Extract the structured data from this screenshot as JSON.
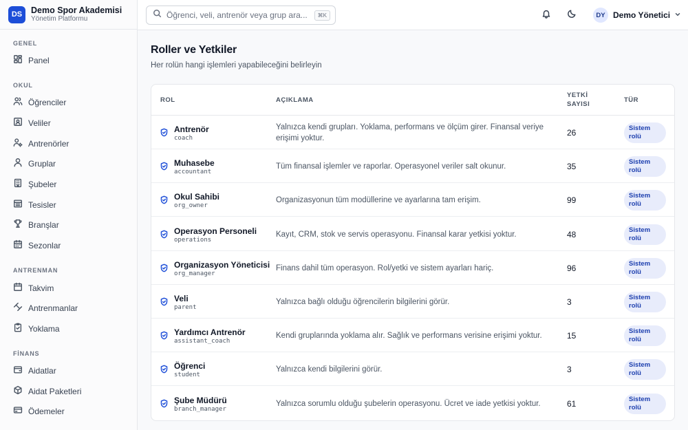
{
  "brand": {
    "logo": "DS",
    "name": "Demo Spor Akademisi",
    "subtitle": "Yönetim Platformu"
  },
  "search": {
    "placeholder": "Öğrenci, veli, antrenör veya grup ara...",
    "shortcut": "⌘K"
  },
  "header_icons": [
    "bell-icon",
    "moon-icon"
  ],
  "user": {
    "initials": "DY",
    "name": "Demo Yönetici"
  },
  "sidebar": {
    "sections": [
      {
        "title": "GENEL",
        "items": [
          {
            "label": "Panel",
            "icon": "dashboard-icon"
          }
        ]
      },
      {
        "title": "OKUL",
        "items": [
          {
            "label": "Öğrenciler",
            "icon": "users-icon"
          },
          {
            "label": "Veliler",
            "icon": "contact-card-icon"
          },
          {
            "label": "Antrenörler",
            "icon": "user-cog-icon"
          },
          {
            "label": "Gruplar",
            "icon": "user-icon"
          },
          {
            "label": "Şubeler",
            "icon": "building-icon"
          },
          {
            "label": "Tesisler",
            "icon": "facility-icon"
          },
          {
            "label": "Branşlar",
            "icon": "trophy-icon"
          },
          {
            "label": "Sezonlar",
            "icon": "calendar-days-icon"
          }
        ]
      },
      {
        "title": "ANTRENMAN",
        "items": [
          {
            "label": "Takvim",
            "icon": "calendar-icon"
          },
          {
            "label": "Antrenmanlar",
            "icon": "dumbbell-icon"
          },
          {
            "label": "Yoklama",
            "icon": "clipboard-check-icon"
          }
        ]
      },
      {
        "title": "FİNANS",
        "items": [
          {
            "label": "Aidatlar",
            "icon": "wallet-icon"
          },
          {
            "label": "Aidat Paketleri",
            "icon": "package-icon"
          },
          {
            "label": "Ödemeler",
            "icon": "credit-card-icon"
          }
        ]
      }
    ]
  },
  "page": {
    "title": "Roller ve Yetkiler",
    "subtitle": "Her rolün hangi işlemleri yapabileceğini belirleyin"
  },
  "table": {
    "headers": {
      "role": "ROL",
      "description": "AÇIKLAMA",
      "count_line1": "YETKİ",
      "count_line2": "SAYISI",
      "type": "TÜR"
    },
    "rows": [
      {
        "name": "Antrenör",
        "code": "coach",
        "description": "Yalnızca kendi grupları. Yoklama, performans ve ölçüm girer. Finansal veriye erişimi yoktur.",
        "count": "26",
        "type_line1": "Sistem",
        "type_line2": "rolü"
      },
      {
        "name": "Muhasebe",
        "code": "accountant",
        "description": "Tüm finansal işlemler ve raporlar. Operasyonel veriler salt okunur.",
        "count": "35",
        "type_line1": "Sistem",
        "type_line2": "rolü"
      },
      {
        "name": "Okul Sahibi",
        "code": "org_owner",
        "description": "Organizasyonun tüm modüllerine ve ayarlarına tam erişim.",
        "count": "99",
        "type_line1": "Sistem",
        "type_line2": "rolü"
      },
      {
        "name": "Operasyon Personeli",
        "code": "operations",
        "description": "Kayıt, CRM, stok ve servis operasyonu. Finansal karar yetkisi yoktur.",
        "count": "48",
        "type_line1": "Sistem",
        "type_line2": "rolü"
      },
      {
        "name": "Organizasyon Yöneticisi",
        "code": "org_manager",
        "description": "Finans dahil tüm operasyon. Rol/yetki ve sistem ayarları hariç.",
        "count": "96",
        "type_line1": "Sistem",
        "type_line2": "rolü"
      },
      {
        "name": "Veli",
        "code": "parent",
        "description": "Yalnızca bağlı olduğu öğrencilerin bilgilerini görür.",
        "count": "3",
        "type_line1": "Sistem",
        "type_line2": "rolü"
      },
      {
        "name": "Yardımcı Antrenör",
        "code": "assistant_coach",
        "description": "Kendi gruplarında yoklama alır. Sağlık ve performans verisine erişimi yoktur.",
        "count": "15",
        "type_line1": "Sistem",
        "type_line2": "rolü"
      },
      {
        "name": "Öğrenci",
        "code": "student",
        "description": "Yalnızca kendi bilgilerini görür.",
        "count": "3",
        "type_line1": "Sistem",
        "type_line2": "rolü"
      },
      {
        "name": "Şube Müdürü",
        "code": "branch_manager",
        "description": "Yalnızca sorumlu olduğu şubelerin operasyonu. Ücret ve iade yetkisi yoktur.",
        "count": "61",
        "type_line1": "Sistem",
        "type_line2": "rolü"
      }
    ]
  },
  "colors": {
    "accent": "#1d4ed8",
    "badge_bg": "#e8ecfb",
    "badge_text": "#1e40af"
  }
}
